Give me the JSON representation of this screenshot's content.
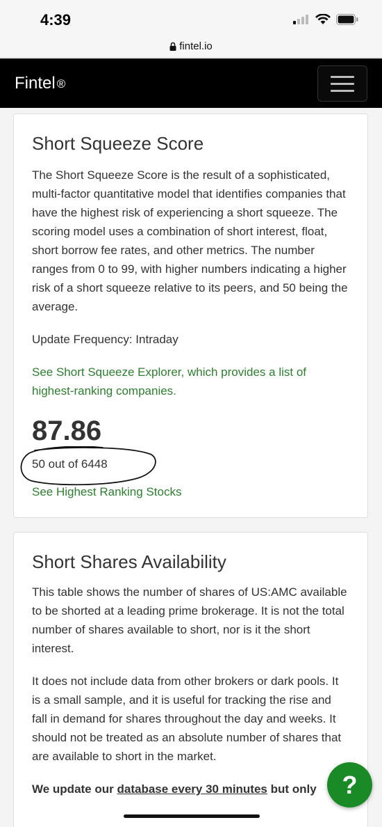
{
  "status_bar": {
    "time": "4:39"
  },
  "url_bar": {
    "domain": "fintel.io"
  },
  "navbar": {
    "brand": "Fintel",
    "brand_mark": "®"
  },
  "squeeze": {
    "title": "Short Squeeze Score",
    "description": "The Short Squeeze Score is the result of a sophisticated, multi-factor quantitative model that identifies companies that have the highest risk of experiencing a short squeeze. The scoring model uses a combination of short interest, float, short borrow fee rates, and other metrics. The number ranges from 0 to 99, with higher numbers indicating a higher risk of a short squeeze relative to its peers, and 50 being the average.",
    "update_frequency": "Update Frequency: Intraday",
    "explorer_link": "See Short Squeeze Explorer, which provides a list of highest-ranking companies.",
    "score": "87.86",
    "rank": "50 out of 6448",
    "ranking_link": "See Highest Ranking Stocks"
  },
  "availability": {
    "title": "Short Shares Availability",
    "para1": "This table shows the number of shares of US:AMC available to be shorted at a leading prime brokerage. It is not the total number of shares available to short, nor is it the short interest.",
    "para2": "It does not include data from other brokers or dark pools. It is a small sample, and it is useful for tracking the rise and fall in demand for shares throughout the day and weeks. It should not be treated as an absolute number of shares that are available to short in the market.",
    "update_prefix": "We update our ",
    "update_link": "database every 30 minutes",
    "update_suffix": " but only"
  },
  "help_button": {
    "label": "?"
  },
  "colors": {
    "link_green": "#2f7d32",
    "help_green": "#1a8a27",
    "navbar": "#000000"
  }
}
